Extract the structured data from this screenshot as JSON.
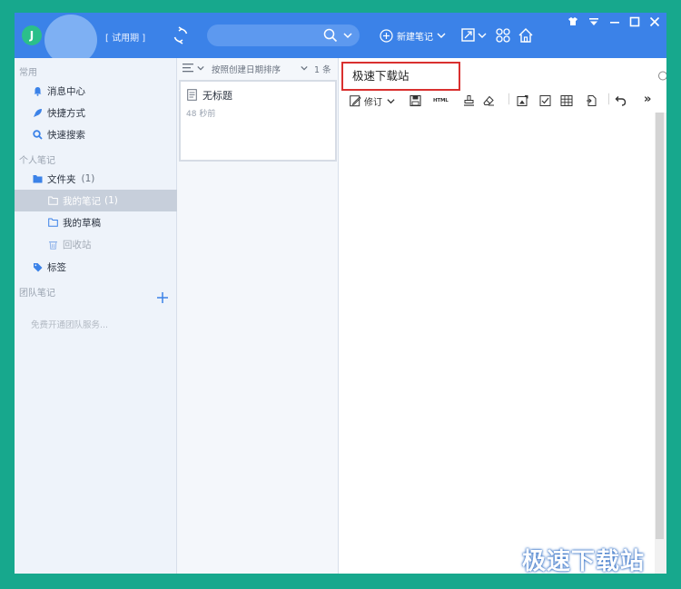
{
  "app": {
    "avatar_initial": "J",
    "trial_label": "[ 试用期 ]",
    "new_note_label": "新建笔记"
  },
  "sidebar": {
    "common_title": "常用",
    "items_common": [
      {
        "label": "消息中心",
        "icon": "bell-icon"
      },
      {
        "label": "快捷方式",
        "icon": "rocket-icon"
      },
      {
        "label": "快速搜索",
        "icon": "search-icon"
      }
    ],
    "personal_title": "个人笔记",
    "folder_label": "文件夹",
    "folder_count": "(1)",
    "my_notes_label": "我的笔记",
    "my_notes_count": "(1)",
    "drafts_label": "我的草稿",
    "recycle_label": "回收站",
    "tags_label": "标签",
    "team_title": "团队笔记",
    "team_hint": "免费开通团队服务..."
  },
  "list": {
    "sort_label": "按照创建日期排序",
    "count_label": "1 条",
    "notes": [
      {
        "title": "无标题",
        "time": "48 秒前"
      }
    ]
  },
  "editor": {
    "title_value": "极速下载站",
    "revise_label": "修订",
    "html_label": "HTML",
    "more_label": "»"
  },
  "watermark": "极速下载站",
  "colors": {
    "titlebar": "#3b82e8",
    "sidebar_bg": "#eef3fa",
    "selected_row": "#c7cfdb",
    "highlight_border": "#d9302f",
    "frame": "#17a88d"
  }
}
